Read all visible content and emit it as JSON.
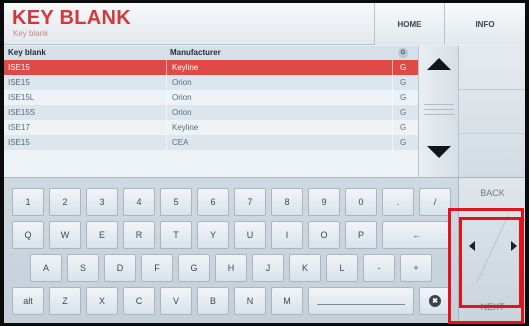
{
  "header": {
    "title": "KEY BLANK",
    "subtitle": "Key blank",
    "home_label": "HOME",
    "info_label": "INFO"
  },
  "table": {
    "columns": [
      "Key blank",
      "Manufacturer",
      "G"
    ],
    "rows": [
      {
        "key": "ISE15",
        "manufacturer": "Keyline",
        "g": "G",
        "selected": true
      },
      {
        "key": "ISE15",
        "manufacturer": "Orion",
        "g": "G",
        "selected": false
      },
      {
        "key": "ISE15L",
        "manufacturer": "Orion",
        "g": "G",
        "selected": false
      },
      {
        "key": "ISE15S",
        "manufacturer": "Orion",
        "g": "G",
        "selected": false
      },
      {
        "key": "ISE17",
        "manufacturer": "Keyline",
        "g": "G",
        "selected": false
      },
      {
        "key": "ISE15",
        "manufacturer": "CEA",
        "g": "G",
        "selected": false
      }
    ]
  },
  "scroll": {
    "up_icon": "arrow-up-icon",
    "down_icon": "arrow-down-icon"
  },
  "keyboard": {
    "row1": [
      "1",
      "2",
      "3",
      "4",
      "5",
      "6",
      "7",
      "8",
      "9",
      "0",
      ".",
      "/"
    ],
    "row2": [
      "Q",
      "W",
      "E",
      "R",
      "T",
      "Y",
      "U",
      "I",
      "O",
      "P",
      "←"
    ],
    "row3": [
      "A",
      "S",
      "D",
      "F",
      "G",
      "H",
      "J",
      "K",
      "L",
      "-",
      "+"
    ],
    "row4": [
      "alt",
      "Z",
      "X",
      "C",
      "V",
      "B",
      "N",
      "M"
    ],
    "delete_symbol": "✖"
  },
  "side": {
    "back_label": "BACK",
    "next_label": "NEXT",
    "left_icon": "arrow-left-icon",
    "right_icon": "arrow-right-icon"
  },
  "colors": {
    "title": "#d2383c",
    "selected_row": "#e04a46",
    "annotation": "#e0141b"
  }
}
